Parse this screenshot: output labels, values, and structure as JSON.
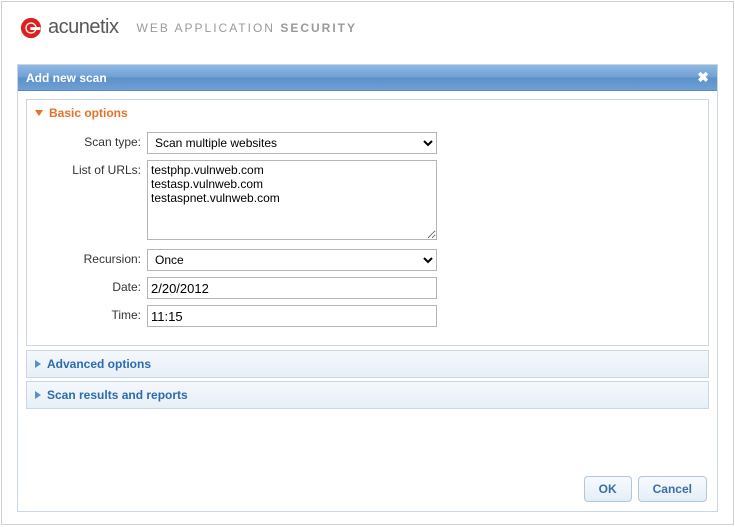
{
  "branding": {
    "product": "acunetix",
    "tagline_a": "WEB APPLICATION",
    "tagline_b": "SECURITY"
  },
  "dialog": {
    "title": "Add new scan"
  },
  "sections": {
    "basic": {
      "title": "Basic options"
    },
    "advanced": {
      "title": "Advanced options"
    },
    "results": {
      "title": "Scan results and reports"
    }
  },
  "form": {
    "scan_type": {
      "label": "Scan type:",
      "value": "Scan multiple websites"
    },
    "urls": {
      "label": "List of URLs:",
      "value": "testphp.vulnweb.com\ntestasp.vulnweb.com\ntestaspnet.vulnweb.com"
    },
    "recursion": {
      "label": "Recursion:",
      "value": "Once"
    },
    "date": {
      "label": "Date:",
      "value": "2/20/2012"
    },
    "time": {
      "label": "Time:",
      "value": "11:15"
    }
  },
  "buttons": {
    "ok": "OK",
    "cancel": "Cancel"
  }
}
